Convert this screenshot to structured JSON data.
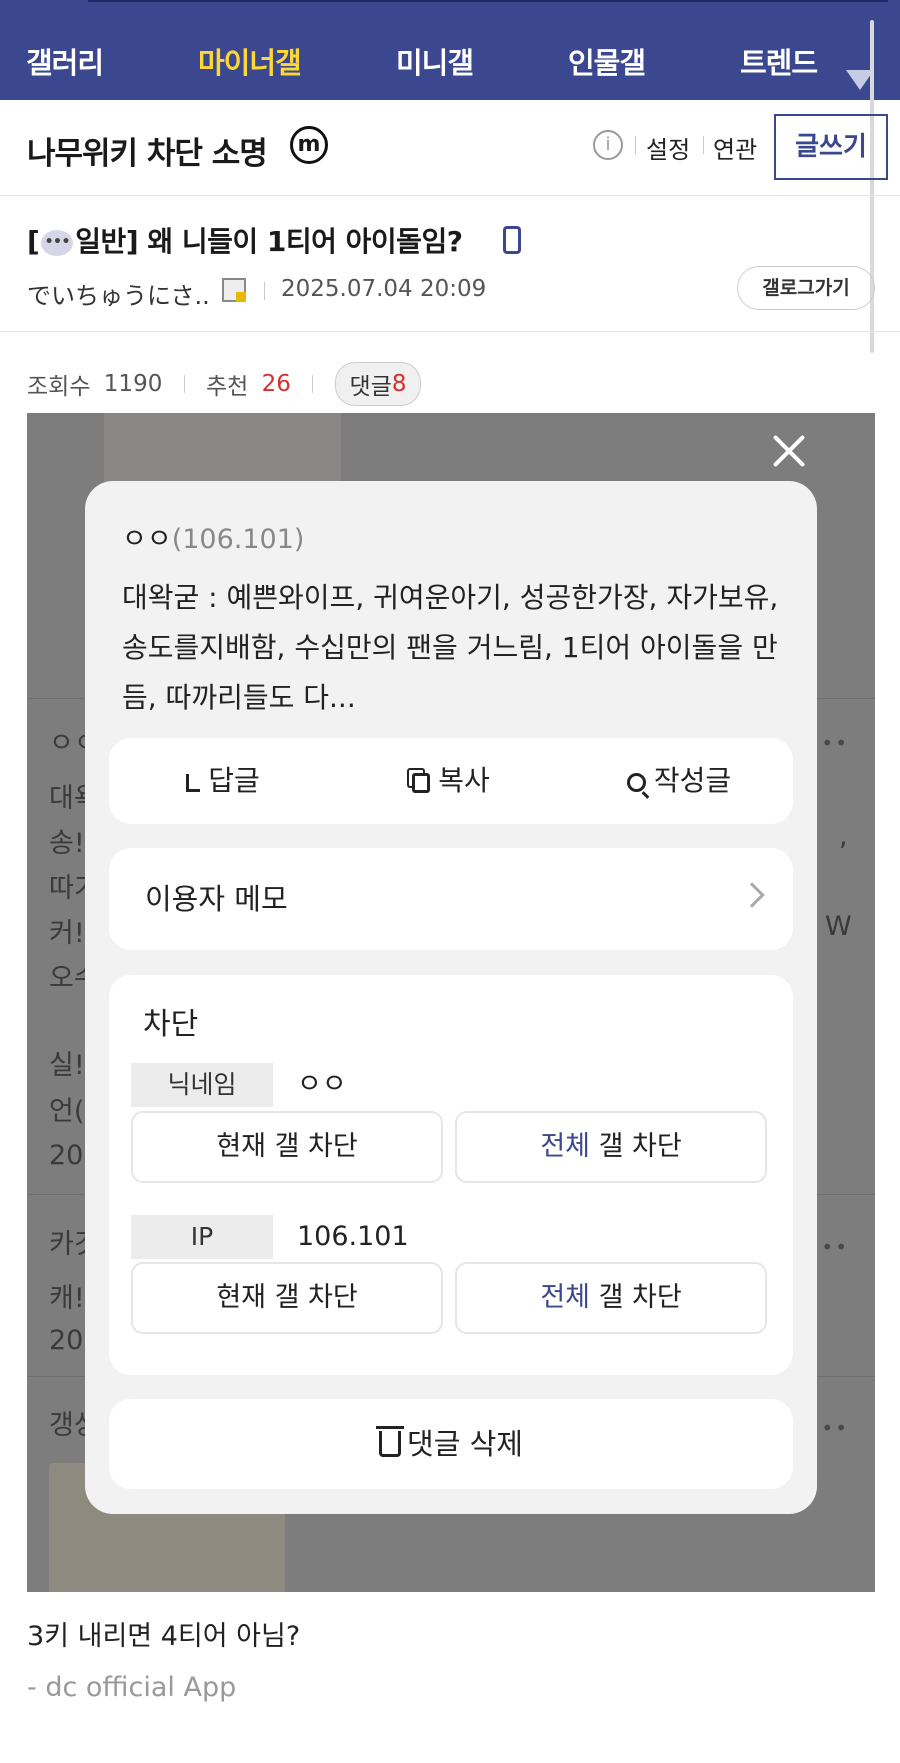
{
  "nav": {
    "items": [
      "갤러리",
      "마이너갤",
      "미니갤",
      "인물갤",
      "트렌드"
    ]
  },
  "gallery": {
    "title": "나무위키 차단 소명",
    "badge": "m",
    "settings": "설정",
    "related": "연관",
    "write": "글쓰기"
  },
  "post": {
    "title_prefix": "[",
    "title_category": "일반",
    "title_rest": "] 왜 니들이 1티어 아이돌임?",
    "author": "でいちゅうにさ..",
    "date": "2025.07.04 20:09",
    "gallog": "갤로그가기",
    "views_label": "조회수",
    "views": "1190",
    "recommend_label": "추천",
    "recommend": "26",
    "comments_label": "댓글",
    "comments": "8"
  },
  "background_comments": {
    "texts": [
      "ㅇㅇ",
      "대욕",
      "송!",
      "따기",
      "커!",
      "오수",
      "실!",
      "언(",
      "20",
      "카깃",
      "캐!",
      "20",
      "갱상"
    ],
    "right_fragments": [
      ",",
      "W"
    ]
  },
  "modal": {
    "nickname": "ㅇㅇ",
    "ip_display": "(106.101)",
    "comment_text": "대왁굳 : 예쁜와이프, 귀여운아기, 성공한가장, 자가보유, 송도를지배함, 수십만의 팬을 거느림, 1티어 아이돌을 만듬, 따까리들도 다...",
    "actions": {
      "reply": "답글",
      "copy": "복사",
      "posts": "작성글"
    },
    "memo": "이용자 메모",
    "block": {
      "title": "차단",
      "nick_tag": "닉네임",
      "nick_value": "ㅇㅇ",
      "ip_tag": "IP",
      "ip_value": "106.101",
      "current_block": "현재 갤 차단",
      "all_prefix": "전체",
      "all_suffix": " 갤 차단"
    },
    "delete": "댓글 삭제"
  },
  "body": {
    "text": "3키 내리면 4티어 아님?",
    "signature": "- dc official App"
  },
  "colors": {
    "brand": "#3b4890",
    "active_nav": "#fdd835",
    "recommend": "#d32f2f"
  }
}
